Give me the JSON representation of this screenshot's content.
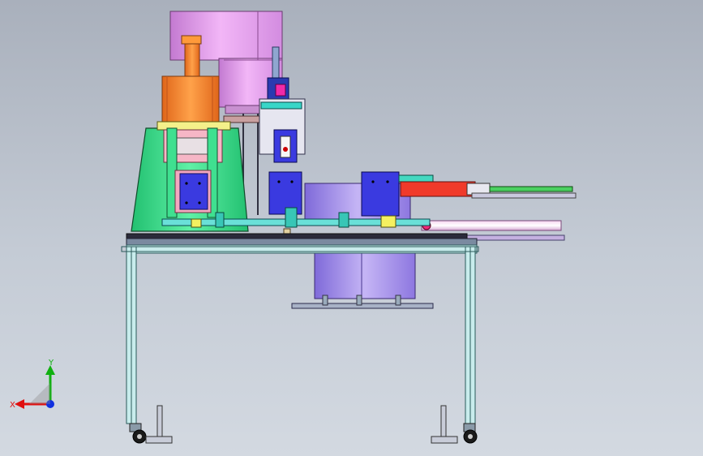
{
  "viewport": {
    "background_top": "#a9b0bc",
    "background_bottom": "#d3d9e1"
  },
  "triad": {
    "x_label": "X",
    "y_label": "Y",
    "x_color": "#e01010",
    "y_color": "#10b010",
    "z_color": "#1030e0"
  },
  "colors": {
    "frame_outline": "#2a5a5a",
    "frame_fill": "#c8ecec",
    "bowl": "#e6a0ee",
    "motor": "#ff8a2a",
    "green_part": "#3fdc8a",
    "blue_block": "#3a3ae0",
    "pink": "#f4b0c8",
    "red_cylinder": "#f03a2a",
    "purple_bowl": "#a48ce8"
  }
}
